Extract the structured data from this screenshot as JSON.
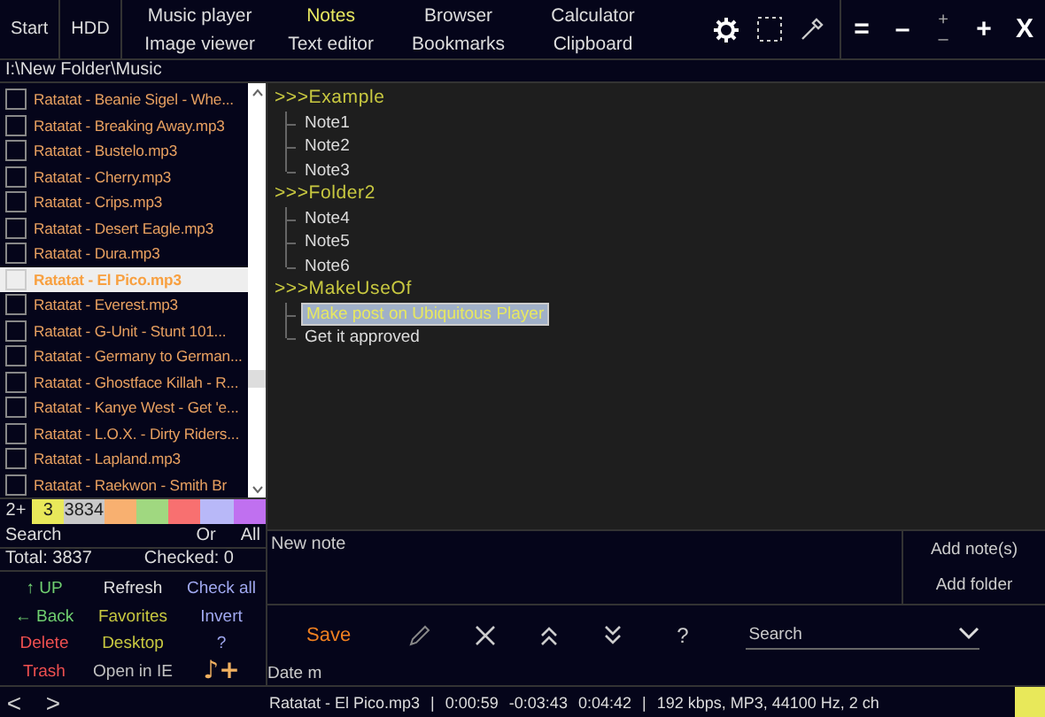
{
  "top_bar": {
    "nav": [
      "Start",
      "HDD"
    ],
    "apps": [
      {
        "label": "Music player",
        "selected": false
      },
      {
        "label": "Notes",
        "selected": true
      },
      {
        "label": "Browser",
        "selected": false
      },
      {
        "label": "Calculator",
        "selected": false
      },
      {
        "label": "Image viewer",
        "selected": false
      },
      {
        "label": "Text editor",
        "selected": false
      },
      {
        "label": "Bookmarks",
        "selected": false
      },
      {
        "label": "Clipboard",
        "selected": false
      }
    ],
    "window_controls": {
      "menu": "=",
      "minimize": "–",
      "size_up": "+",
      "size_down": "–",
      "maximize": "+",
      "close": "X"
    }
  },
  "path": "I:\\New Folder\\Music",
  "files": [
    {
      "name": "Ratatat - Beanie Sigel - Whe...",
      "checked": false,
      "selected": false
    },
    {
      "name": "Ratatat - Breaking Away.mp3",
      "checked": false,
      "selected": false
    },
    {
      "name": "Ratatat - Bustelo.mp3",
      "checked": false,
      "selected": false
    },
    {
      "name": "Ratatat - Cherry.mp3",
      "checked": false,
      "selected": false
    },
    {
      "name": "Ratatat - Crips.mp3",
      "checked": false,
      "selected": false
    },
    {
      "name": "Ratatat - Desert Eagle.mp3",
      "checked": false,
      "selected": false
    },
    {
      "name": "Ratatat - Dura.mp3",
      "checked": false,
      "selected": false
    },
    {
      "name": "Ratatat - El Pico.mp3",
      "checked": false,
      "selected": true
    },
    {
      "name": "Ratatat - Everest.mp3",
      "checked": false,
      "selected": false
    },
    {
      "name": "Ratatat - G-Unit - Stunt 101...",
      "checked": false,
      "selected": false
    },
    {
      "name": "Ratatat - Germany to German...",
      "checked": false,
      "selected": false
    },
    {
      "name": "Ratatat - Ghostface Killah - R...",
      "checked": false,
      "selected": false
    },
    {
      "name": "Ratatat - Kanye West - Get 'e...",
      "checked": false,
      "selected": false
    },
    {
      "name": "Ratatat - L.O.X. - Dirty Riders...",
      "checked": false,
      "selected": false
    },
    {
      "name": "Ratatat - Lapland.mp3",
      "checked": false,
      "selected": false
    },
    {
      "name": "Ratatat - Raekwon - Smith Br",
      "checked": false,
      "selected": false
    }
  ],
  "tags": {
    "label": "2+",
    "items": [
      {
        "color": "#e8e85a",
        "label": "3"
      },
      {
        "color": "#c8c8c8",
        "label": "3834"
      },
      {
        "color": "#f8b070"
      },
      {
        "color": "#a0d880"
      },
      {
        "color": "#f87070"
      },
      {
        "color": "#b8b8f8"
      },
      {
        "color": "#c070f0"
      }
    ]
  },
  "search": {
    "label": "Search",
    "or": "Or",
    "all": "All"
  },
  "totals": {
    "total": "Total: 3837",
    "checked": "Checked: 0"
  },
  "actions": [
    {
      "label": "↑ UP",
      "color": "#70d070"
    },
    {
      "label": "Refresh",
      "color": "#e0e0e0"
    },
    {
      "label": "Check all",
      "color": "#a0a8f0"
    },
    {
      "label": "← Back",
      "color": "#70d070"
    },
    {
      "label": "Favorites",
      "color": "#c8c840"
    },
    {
      "label": "Invert",
      "color": "#a0a8f0"
    },
    {
      "label": "Delete",
      "color": "#f05050"
    },
    {
      "label": "Desktop",
      "color": "#c8c840"
    },
    {
      "label": "?",
      "color": "#a0a8f0"
    },
    {
      "label": "Trash",
      "color": "#f05050"
    },
    {
      "label": "Open in IE",
      "color": "#c0c0c0"
    },
    {
      "label": "♪+",
      "color": "#f0b060"
    }
  ],
  "notes_tree": [
    {
      "label": ">>>Example",
      "children": [
        {
          "label": "Note1",
          "selected": false
        },
        {
          "label": "Note2",
          "selected": false
        },
        {
          "label": "Note3",
          "selected": false
        }
      ]
    },
    {
      "label": ">>>Folder2",
      "children": [
        {
          "label": "Note4",
          "selected": false
        },
        {
          "label": "Note5",
          "selected": false
        },
        {
          "label": "Note6",
          "selected": false
        }
      ]
    },
    {
      "label": ">>>MakeUseOf",
      "children": [
        {
          "label": "Make post on Ubiquitous Player",
          "selected": true
        },
        {
          "label": "Get it approved",
          "selected": false
        }
      ]
    }
  ],
  "note_input": {
    "placeholder": "New note"
  },
  "note_buttons": [
    "Add note(s)",
    "Add folder"
  ],
  "toolbar": {
    "save": "Save",
    "help": "?",
    "search_placeholder": "Search"
  },
  "date_label": "Date m",
  "status_bar": {
    "prev": "<",
    "next": ">",
    "track": "Ratatat - El Pico.mp3",
    "sep1": "|",
    "elapsed": "0:00:59",
    "remaining": "-0:03:43",
    "length": "0:04:42",
    "sep2": "|",
    "info": "192 kbps, MP3, 44100 Hz, 2 ch"
  }
}
